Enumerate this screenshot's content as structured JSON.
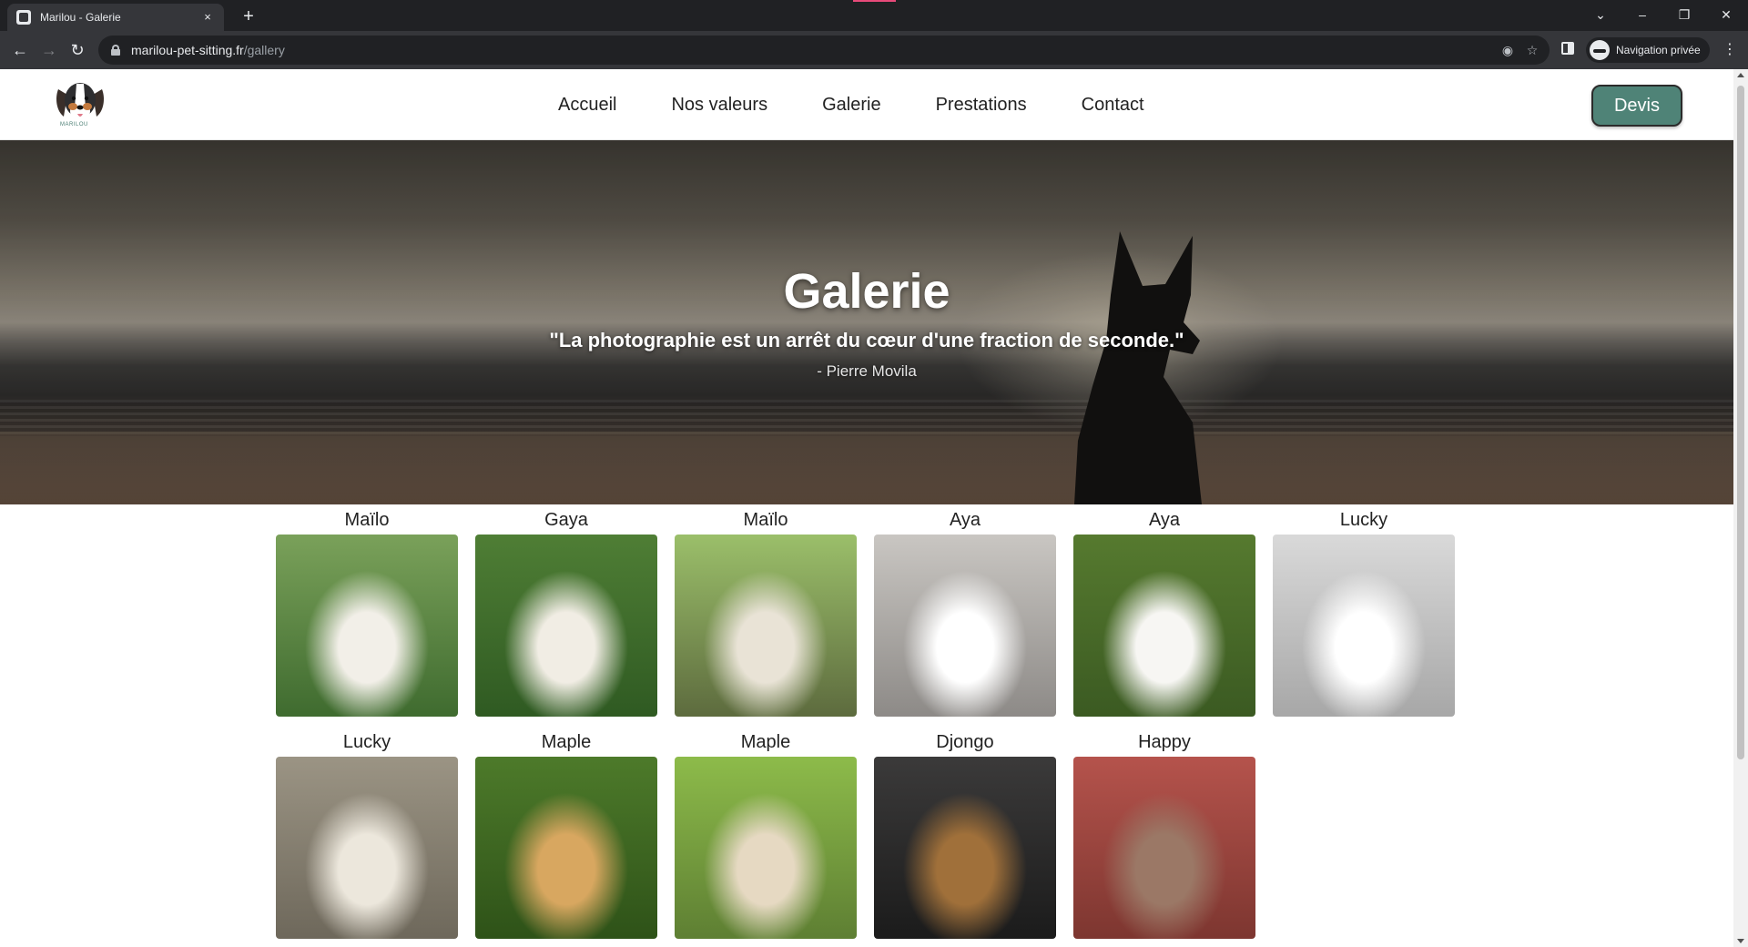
{
  "browser": {
    "tab_title": "Marilou - Galerie",
    "tab_close_icon": "×",
    "new_tab_icon": "+",
    "url_host": "marilou-pet-sitting.fr",
    "url_path": "/gallery",
    "private_label": "Navigation privée"
  },
  "site": {
    "logo_caption": "MARILOU",
    "nav": [
      "Accueil",
      "Nos valeurs",
      "Galerie",
      "Prestations",
      "Contact"
    ],
    "cta_label": "Devis",
    "accent_color": "#4f8377"
  },
  "hero": {
    "title": "Galerie",
    "quote": "\"La photographie est un arrêt du cœur d'une fraction de seconde.\"",
    "author": "- Pierre Movila"
  },
  "gallery": [
    {
      "name": "Maïlo",
      "palette": [
        "#7aa15a",
        "#3f6b2f",
        "#f2efe8"
      ]
    },
    {
      "name": "Gaya",
      "palette": [
        "#4f7e35",
        "#2f5a22",
        "#f1ede4"
      ]
    },
    {
      "name": "Maïlo",
      "palette": [
        "#9bbf6a",
        "#5d6b3e",
        "#e9e3d6"
      ]
    },
    {
      "name": "Aya",
      "palette": [
        "#c9c6c2",
        "#8d8a87",
        "#ffffff"
      ]
    },
    {
      "name": "Aya",
      "palette": [
        "#567a2f",
        "#3b5a22",
        "#f7f6f3"
      ]
    },
    {
      "name": "Lucky",
      "palette": [
        "#d9d9d9",
        "#a7a7a7",
        "#ffffff"
      ]
    },
    {
      "name": "Lucky",
      "palette": [
        "#9b9484",
        "#6e685b",
        "#ece7dc"
      ]
    },
    {
      "name": "Maple",
      "palette": [
        "#4d7a2a",
        "#2e5218",
        "#d8a760"
      ]
    },
    {
      "name": "Maple",
      "palette": [
        "#8dbb4a",
        "#5e7f33",
        "#e6d9c2"
      ]
    },
    {
      "name": "Djongo",
      "palette": [
        "#3b3a3a",
        "#1b1b1b",
        "#a0703a"
      ]
    },
    {
      "name": "Happy",
      "palette": [
        "#b5534c",
        "#7d3630",
        "#9b7866"
      ]
    }
  ]
}
